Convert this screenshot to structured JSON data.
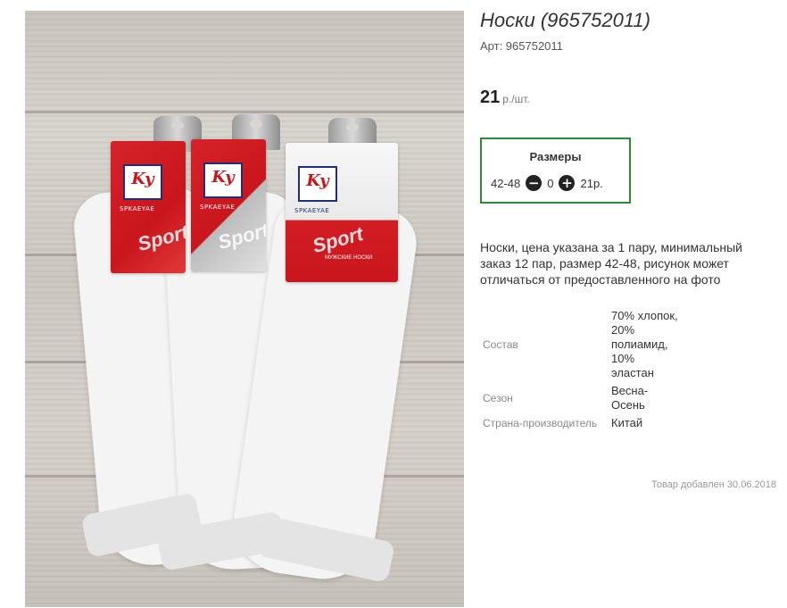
{
  "product": {
    "title": "Носки (965752011)",
    "sku_label": "Арт: 965752011",
    "price_value": "21",
    "price_unit": "р./шт."
  },
  "sizes": {
    "title": "Размеры",
    "size": "42-48",
    "quantity": "0",
    "price": "21р.",
    "minus_icon": "minus-circle-icon",
    "plus_icon": "plus-circle-icon",
    "border_color": "#2e8b2e"
  },
  "description": "Носки, цена указана за 1 пару, минимальный заказ 12 пар, размер 42-48, рисунок может отличаться от предоставленного на фото",
  "properties": [
    {
      "name": "Состав",
      "value": "70% хлопок, 20% полиамид, 10% эластан"
    },
    {
      "name": "Сезон",
      "value": "Весна-Осень"
    },
    {
      "name": "Страна-производитель",
      "value": "Китай"
    }
  ],
  "added_date": "Товар добавлен 30.06.2018",
  "photo": {
    "brand_logo": "Ky",
    "brand_name": "SPKAEYAE",
    "print": "Sport",
    "tag_text": "МУЖСКИЕ НОСКИ"
  }
}
